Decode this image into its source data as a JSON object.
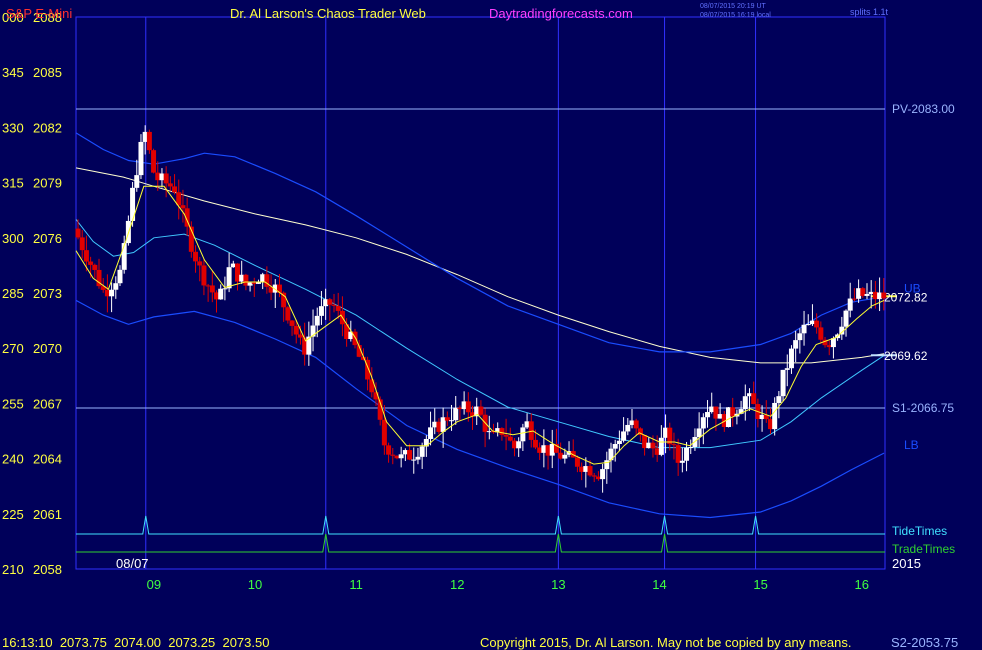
{
  "header": {
    "instrument": "S&P E-Mini",
    "title": "Dr. Al Larson's Chaos Trader Web",
    "site": "Daytradingforecasts.com",
    "time_utc": "08/07/2015 20:19 UT",
    "time_local": "08/07/2015 16:19 local",
    "splits": "splits 1.1t"
  },
  "footer": {
    "quote": "16:13:10  2073.75  2074.00  2073.25  2073.50",
    "copyright": "Copyright 2015, Dr. Al Larson. May not be copied by any means.",
    "s2": "S2-2053.75"
  },
  "colors": {
    "background": "#00005a",
    "frame": "#3030ff",
    "price_label": "#ffff40",
    "left_label": "#ffff40",
    "x_label": "#40ff40",
    "up_bar": "#ffffff",
    "down_bar": "#e00000",
    "ema_fast": "#ffff30",
    "mid_avg": "#ffffd0",
    "band": "#1a4cff",
    "inner_band": "#40c8ff",
    "level": "#9ab4ff",
    "tide": "#40e0ff",
    "trade": "#30d030",
    "vline": "#3030ff"
  },
  "chart_data": {
    "type": "candlestick",
    "y_labels_left": [
      "000",
      "345",
      "330",
      "315",
      "300",
      "285",
      "270",
      "255",
      "240",
      "225",
      "210"
    ],
    "y_ticks": [
      2088,
      2085,
      2082,
      2079,
      2076,
      2073,
      2070,
      2067,
      2064,
      2061,
      2058
    ],
    "ylim": [
      2058,
      2088
    ],
    "x_ticks": [
      {
        "label": "09",
        "hour": 9
      },
      {
        "label": "10",
        "hour": 10
      },
      {
        "label": "11",
        "hour": 11
      },
      {
        "label": "12",
        "hour": 12
      },
      {
        "label": "13",
        "hour": 13
      },
      {
        "label": "14",
        "hour": 14
      },
      {
        "label": "15",
        "hour": 15
      },
      {
        "label": "16",
        "hour": 16
      }
    ],
    "xlim": [
      8.23,
      16.23
    ],
    "date_label": "08/07",
    "year_label": "2015",
    "vertical_lines": [
      8.92,
      10.7,
      13.0,
      14.05,
      14.95
    ],
    "levels": [
      {
        "label": "PV-2083.00",
        "value": 2083.0
      },
      {
        "label": "S1-2066.75",
        "value": 2066.75
      }
    ],
    "band_labels": [
      {
        "label": "UB",
        "value": 2072.8
      },
      {
        "label": "LB",
        "value": 2064.3
      }
    ],
    "price_markers": [
      {
        "label": "2072.82",
        "value": 2072.82
      },
      {
        "label": "2069.62",
        "value": 2069.62
      }
    ],
    "timing": [
      {
        "name": "TideTimes",
        "peaks": [
          8.92,
          10.7,
          13.0,
          14.05,
          14.95
        ]
      },
      {
        "name": "TradeTimes",
        "peaks": [
          10.7,
          13.0,
          14.05
        ]
      }
    ],
    "anchors": [
      [
        8.25,
        2076.5
      ],
      [
        8.4,
        2074.8
      ],
      [
        8.55,
        2073.0
      ],
      [
        8.72,
        2074.2
      ],
      [
        8.85,
        2079.2
      ],
      [
        8.95,
        2081.8
      ],
      [
        9.05,
        2079.3
      ],
      [
        9.25,
        2078.7
      ],
      [
        9.38,
        2076.2
      ],
      [
        9.5,
        2074.2
      ],
      [
        9.68,
        2072.5
      ],
      [
        9.8,
        2074.5
      ],
      [
        9.95,
        2073.4
      ],
      [
        10.1,
        2074.0
      ],
      [
        10.25,
        2073.2
      ],
      [
        10.4,
        2071.5
      ],
      [
        10.52,
        2069.8
      ],
      [
        10.65,
        2071.8
      ],
      [
        10.8,
        2072.5
      ],
      [
        10.92,
        2071.2
      ],
      [
        11.05,
        2069.8
      ],
      [
        11.2,
        2067.8
      ],
      [
        11.32,
        2064.8
      ],
      [
        11.48,
        2064.0
      ],
      [
        11.62,
        2064.3
      ],
      [
        11.8,
        2065.5
      ],
      [
        11.95,
        2066.3
      ],
      [
        12.1,
        2066.7
      ],
      [
        12.25,
        2066.6
      ],
      [
        12.38,
        2065.0
      ],
      [
        12.5,
        2065.6
      ],
      [
        12.6,
        2064.5
      ],
      [
        12.72,
        2066.0
      ],
      [
        12.85,
        2064.7
      ],
      [
        13.0,
        2064.3
      ],
      [
        13.15,
        2064.0
      ],
      [
        13.3,
        2063.6
      ],
      [
        13.45,
        2063.2
      ],
      [
        13.62,
        2065.0
      ],
      [
        13.75,
        2066.0
      ],
      [
        13.88,
        2064.8
      ],
      [
        14.0,
        2064.5
      ],
      [
        14.12,
        2065.4
      ],
      [
        14.22,
        2063.8
      ],
      [
        14.32,
        2064.6
      ],
      [
        14.45,
        2066.3
      ],
      [
        14.55,
        2067.0
      ],
      [
        14.65,
        2066.0
      ],
      [
        14.78,
        2066.6
      ],
      [
        14.9,
        2067.4
      ],
      [
        15.05,
        2066.2
      ],
      [
        15.12,
        2065.5
      ],
      [
        15.25,
        2068.2
      ],
      [
        15.35,
        2069.8
      ],
      [
        15.45,
        2071.0
      ],
      [
        15.58,
        2071.3
      ],
      [
        15.7,
        2070.2
      ],
      [
        15.8,
        2071.0
      ],
      [
        15.9,
        2072.2
      ],
      [
        16.0,
        2072.9
      ],
      [
        16.12,
        2072.8
      ],
      [
        16.22,
        2072.8
      ]
    ],
    "bar_step_hours": 0.0415,
    "series": [
      {
        "name": "EMA",
        "type": "line",
        "points": [
          [
            8.23,
            2075.3
          ],
          [
            8.4,
            2073.8
          ],
          [
            8.55,
            2073.2
          ],
          [
            8.72,
            2075.8
          ],
          [
            8.9,
            2078.8
          ],
          [
            9.1,
            2078.8
          ],
          [
            9.3,
            2077.3
          ],
          [
            9.5,
            2074.8
          ],
          [
            9.7,
            2073.3
          ],
          [
            9.9,
            2073.6
          ],
          [
            10.1,
            2073.6
          ],
          [
            10.3,
            2072.8
          ],
          [
            10.5,
            2070.4
          ],
          [
            10.65,
            2071.0
          ],
          [
            10.85,
            2071.8
          ],
          [
            11.0,
            2070.5
          ],
          [
            11.15,
            2068.5
          ],
          [
            11.3,
            2066.0
          ],
          [
            11.5,
            2064.7
          ],
          [
            11.7,
            2064.7
          ],
          [
            11.85,
            2065.4
          ],
          [
            12.0,
            2066.0
          ],
          [
            12.2,
            2066.4
          ],
          [
            12.35,
            2065.5
          ],
          [
            12.55,
            2065.3
          ],
          [
            12.75,
            2065.5
          ],
          [
            12.95,
            2064.8
          ],
          [
            13.15,
            2064.2
          ],
          [
            13.35,
            2063.7
          ],
          [
            13.5,
            2063.8
          ],
          [
            13.65,
            2064.7
          ],
          [
            13.8,
            2065.4
          ],
          [
            14.0,
            2064.9
          ],
          [
            14.15,
            2064.9
          ],
          [
            14.3,
            2064.7
          ],
          [
            14.5,
            2065.6
          ],
          [
            14.7,
            2066.2
          ],
          [
            14.9,
            2066.7
          ],
          [
            15.1,
            2066.3
          ],
          [
            15.25,
            2067.3
          ],
          [
            15.4,
            2069.0
          ],
          [
            15.55,
            2070.2
          ],
          [
            15.75,
            2070.6
          ],
          [
            15.95,
            2071.6
          ],
          [
            16.1,
            2072.3
          ],
          [
            16.22,
            2072.6
          ]
        ]
      },
      {
        "name": "Center",
        "type": "line",
        "points": [
          [
            8.23,
            2079.8
          ],
          [
            8.7,
            2079.3
          ],
          [
            9.0,
            2078.8
          ],
          [
            9.5,
            2078.0
          ],
          [
            10.0,
            2077.3
          ],
          [
            10.5,
            2076.7
          ],
          [
            11.0,
            2076.0
          ],
          [
            11.5,
            2075.1
          ],
          [
            12.0,
            2074.0
          ],
          [
            12.5,
            2072.8
          ],
          [
            13.0,
            2071.8
          ],
          [
            13.5,
            2070.9
          ],
          [
            14.0,
            2070.1
          ],
          [
            14.5,
            2069.5
          ],
          [
            15.0,
            2069.2
          ],
          [
            15.5,
            2069.2
          ],
          [
            16.0,
            2069.5
          ],
          [
            16.22,
            2069.7
          ]
        ]
      },
      {
        "name": "UB",
        "type": "line",
        "points": [
          [
            8.23,
            2081.7
          ],
          [
            8.5,
            2080.8
          ],
          [
            8.75,
            2080.2
          ],
          [
            9.0,
            2080.0
          ],
          [
            9.3,
            2080.3
          ],
          [
            9.5,
            2080.6
          ],
          [
            9.8,
            2080.4
          ],
          [
            10.2,
            2079.5
          ],
          [
            10.6,
            2078.5
          ],
          [
            11.0,
            2077.2
          ],
          [
            11.5,
            2075.5
          ],
          [
            12.0,
            2073.8
          ],
          [
            12.5,
            2072.3
          ],
          [
            13.0,
            2071.3
          ],
          [
            13.5,
            2070.3
          ],
          [
            14.0,
            2069.8
          ],
          [
            14.5,
            2069.8
          ],
          [
            15.0,
            2070.2
          ],
          [
            15.3,
            2070.8
          ],
          [
            15.6,
            2071.8
          ],
          [
            15.9,
            2072.5
          ],
          [
            16.22,
            2072.8
          ]
        ]
      },
      {
        "name": "Inner",
        "type": "line",
        "points": [
          [
            8.23,
            2077.0
          ],
          [
            8.4,
            2075.8
          ],
          [
            8.6,
            2075.0
          ],
          [
            8.8,
            2075.2
          ],
          [
            9.0,
            2076.0
          ],
          [
            9.3,
            2076.2
          ],
          [
            9.6,
            2075.6
          ],
          [
            10.0,
            2074.5
          ],
          [
            10.5,
            2073.2
          ],
          [
            11.0,
            2071.8
          ],
          [
            11.5,
            2070.0
          ],
          [
            12.0,
            2068.3
          ],
          [
            12.5,
            2066.8
          ],
          [
            13.0,
            2066.0
          ],
          [
            13.5,
            2065.2
          ],
          [
            14.0,
            2064.6
          ],
          [
            14.5,
            2064.6
          ],
          [
            15.0,
            2065.0
          ],
          [
            15.3,
            2066.0
          ],
          [
            15.6,
            2067.3
          ],
          [
            16.0,
            2068.8
          ],
          [
            16.22,
            2069.6
          ]
        ]
      },
      {
        "name": "LB",
        "type": "line",
        "points": [
          [
            8.23,
            2072.6
          ],
          [
            8.5,
            2071.8
          ],
          [
            8.75,
            2071.3
          ],
          [
            9.0,
            2071.7
          ],
          [
            9.4,
            2072.0
          ],
          [
            9.8,
            2071.4
          ],
          [
            10.2,
            2070.5
          ],
          [
            10.6,
            2069.5
          ],
          [
            11.0,
            2067.8
          ],
          [
            11.5,
            2065.8
          ],
          [
            12.0,
            2064.5
          ],
          [
            12.5,
            2063.5
          ],
          [
            13.0,
            2062.6
          ],
          [
            13.5,
            2061.6
          ],
          [
            14.0,
            2061.0
          ],
          [
            14.5,
            2060.8
          ],
          [
            15.0,
            2061.1
          ],
          [
            15.3,
            2061.7
          ],
          [
            15.6,
            2062.5
          ],
          [
            15.9,
            2063.4
          ],
          [
            16.22,
            2064.3
          ]
        ]
      }
    ]
  }
}
